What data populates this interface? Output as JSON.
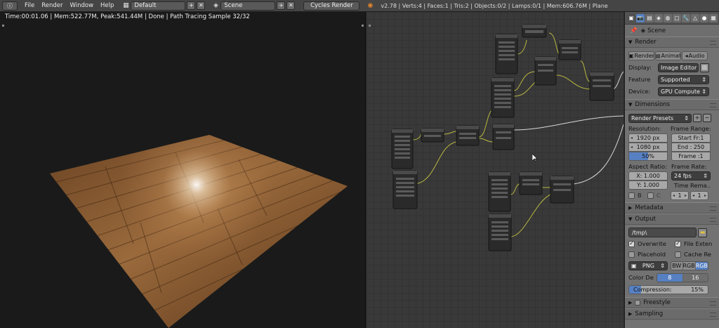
{
  "header": {
    "menus": [
      "File",
      "Render",
      "Window",
      "Help"
    ],
    "screen_layout": "Default",
    "scene": "Scene",
    "render_engine": "Cycles Render",
    "stats": "v2.78 | Verts:4 | Faces:1 | Tris:2 | Objects:0/2 | Lamps:0/1 | Mem:606.76M | Plane"
  },
  "render_view": {
    "status": "Time:00:01.06 | Mem:522.77M, Peak:541.44M | Done | Path Tracing Sample 32/32"
  },
  "properties": {
    "breadcrumb": "Scene",
    "render_panel": {
      "title": "Render",
      "buttons": [
        "Render",
        "Animat",
        "Audio"
      ],
      "display_label": "Display:",
      "display_value": "Image Editor",
      "feature_label": "Feature",
      "feature_value": "Supported",
      "device_label": "Device:",
      "device_value": "GPU Compute"
    },
    "dimensions_panel": {
      "title": "Dimensions",
      "presets": "Render Presets",
      "resolution_label": "Resolution:",
      "res_x": "1920 px",
      "res_y": "1080 px",
      "res_percent": "50%",
      "frame_range_label": "Frame Range:",
      "start": "Start Fr:1",
      "end": "End : 250",
      "frame": "Frame :1",
      "aspect_label": "Aspect Ratio:",
      "aspect_x": "X:   1.000",
      "aspect_y": "Y:   1.000",
      "frame_rate_label": "Frame Rate:",
      "fps": "24 fps",
      "time_remap_label": "Time Rema...",
      "remap_old": "1",
      "remap_new": "1",
      "border_b": "B",
      "border_c": "C"
    },
    "metadata_panel": {
      "title": "Metadata"
    },
    "output_panel": {
      "title": "Output",
      "path": "/tmp\\",
      "overwrite": "Overwrite",
      "file_ext": "File Exten",
      "placeholder": "Placehold",
      "cache": "Cache Re",
      "format": "PNG",
      "color_modes": [
        "BW",
        "RGB",
        "RGB"
      ],
      "color_depth_label": "Color De",
      "depths": [
        "8",
        "16"
      ],
      "compression": "Compression:",
      "compression_value": "15%"
    },
    "freestyle_panel": {
      "title": "Freestyle"
    },
    "sampling_panel": {
      "title": "Sampling"
    }
  },
  "colors": {
    "accent_blue": "#5680c2",
    "header_bg": "#454545",
    "panel_bg": "#727272",
    "node_bg": "#393939"
  }
}
